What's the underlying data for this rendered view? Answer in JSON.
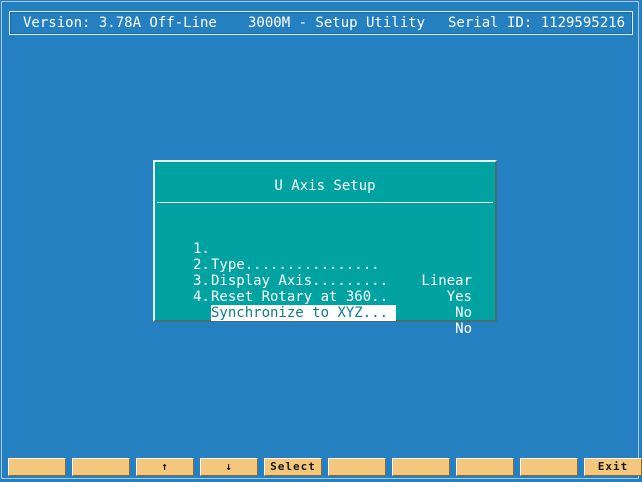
{
  "header": {
    "version": "Version: 3.78A Off-Line",
    "title": "3000M - Setup Utility",
    "serial": "Serial ID: 1129595216"
  },
  "dialog": {
    "title": "U Axis Setup",
    "items": [
      {
        "num": "1.",
        "label": "Type................",
        "value": "Linear"
      },
      {
        "num": "2.",
        "label": "Display Axis.........",
        "value": "Yes"
      },
      {
        "num": "3.",
        "label": "Reset Rotary at 360..",
        "value": "No"
      },
      {
        "num": "4.",
        "label": "Synchronize to XYZ...",
        "value": "No"
      }
    ],
    "selected_index": 3
  },
  "function_keys": [
    "",
    "",
    "↑",
    "↓",
    "Select",
    "",
    "",
    "",
    "",
    "Exit"
  ],
  "colors": {
    "background": "#2480c0",
    "dialog": "#00a2a2",
    "function_key": "#f4c87c",
    "selection_text": "#0c7e8e"
  }
}
